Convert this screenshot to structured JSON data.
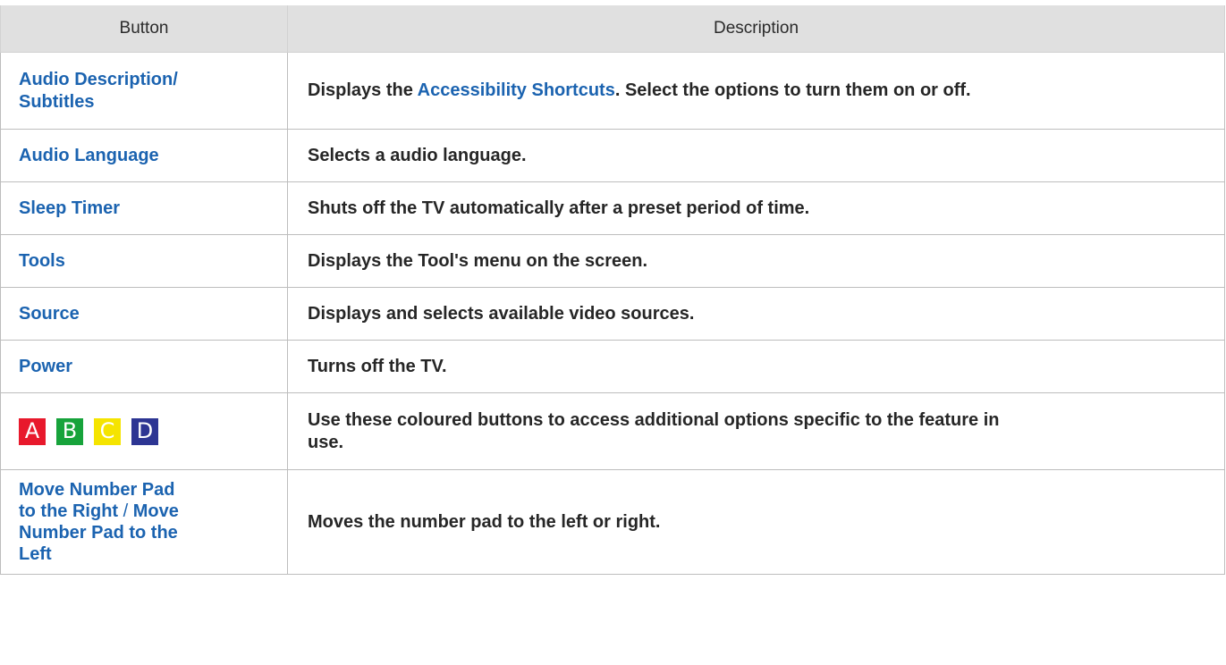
{
  "table": {
    "headers": [
      "Button",
      "Description"
    ],
    "rows": [
      {
        "button_line1": "Audio Description/",
        "button_line2": "Subtitles",
        "desc_pre": "Displays the ",
        "desc_link": "Accessibility Shortcuts",
        "desc_post": ". Select the options to turn them on or off."
      },
      {
        "button": "Audio Language",
        "desc": "Selects a audio language."
      },
      {
        "button": "Sleep Timer",
        "desc": "Shuts off the TV automatically after a preset period of time."
      },
      {
        "button": "Tools",
        "desc": "Displays the Tool's menu on the screen."
      },
      {
        "button": "Source",
        "desc": "Displays and selects available video sources."
      },
      {
        "button": "Power",
        "desc": "Turns off the TV."
      },
      {
        "keys": [
          {
            "label": "A",
            "bg": "#e8192c",
            "fg": "#ffffff"
          },
          {
            "label": "B",
            "bg": "#17a33b",
            "fg": "#ffffff"
          },
          {
            "label": "C",
            "bg": "#f5e400",
            "fg": "#ffffff"
          },
          {
            "label": "D",
            "bg": "#2d3593",
            "fg": "#ffffff"
          }
        ],
        "desc_line1": "Use these coloured buttons to access additional options specific to the feature in",
        "desc_line2": "use."
      },
      {
        "button_line1": "Move Number Pad",
        "button_line2": "to the Right",
        "button_sep": " / ",
        "button_line2b": "Move",
        "button_line3": "Number Pad to the",
        "button_line4": "Left",
        "desc": "Moves the number pad to the left or right."
      }
    ]
  }
}
